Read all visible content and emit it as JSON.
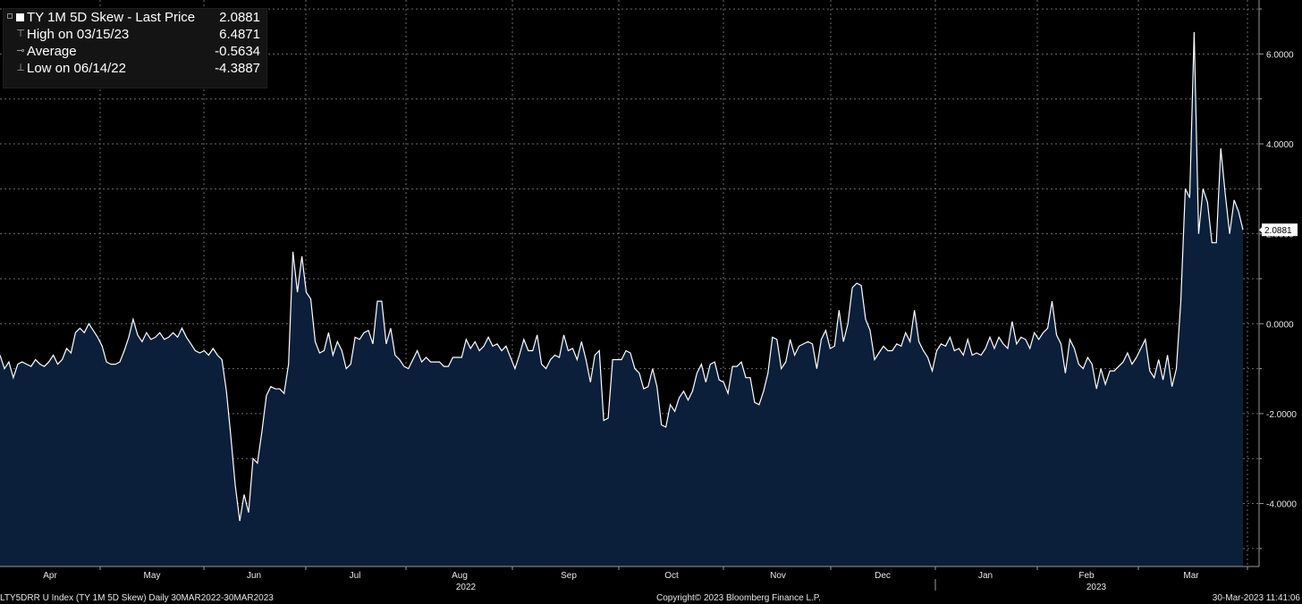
{
  "legend": {
    "series_label": "TY 1M 5D Skew - Last Price",
    "series_value": "2.0881",
    "high_label": "High on 03/15/23",
    "high_value": "6.4871",
    "avg_label": "Average",
    "avg_value": "-0.5634",
    "low_label": "Low on 06/14/22",
    "low_value": "-4.3887"
  },
  "footer": {
    "left": "LTY5DRR U Index (TY 1M 5D Skew)  Daily 30MAR2022-30MAR2023",
    "center": "Copyright© 2023 Bloomberg Finance L.P.",
    "right": "30-Mar-2023 11:41:06"
  },
  "colors": {
    "background": "#000000",
    "area_fill": "#0b1f3a",
    "line": "#ffffff",
    "grid": "#6a6a6a"
  },
  "chart_data": {
    "type": "area",
    "series": [
      {
        "values": [
          -0.7,
          -1.0,
          -0.85,
          -1.2,
          -0.9,
          -0.85,
          -0.9,
          -0.95,
          -0.8,
          -0.9,
          -0.95,
          -0.85,
          -0.7,
          -0.9,
          -0.8,
          -0.55,
          -0.65,
          -0.2,
          -0.1,
          -0.2,
          0.0,
          -0.15,
          -0.3,
          -0.5,
          -0.85,
          -0.9,
          -0.9,
          -0.85,
          -0.6,
          -0.3,
          0.1,
          -0.25,
          -0.4,
          -0.2,
          -0.35,
          -0.3,
          -0.2,
          -0.35,
          -0.3,
          -0.2,
          -0.3,
          -0.1,
          -0.3,
          -0.45,
          -0.6,
          -0.65,
          -0.6,
          -0.7,
          -0.55,
          -0.7,
          -0.8,
          -1.5,
          -2.5,
          -3.6,
          -4.3887,
          -3.8,
          -4.2,
          -3.0,
          -3.1,
          -2.4,
          -1.6,
          -1.4,
          -1.45,
          -1.45,
          -1.55,
          -0.9,
          1.6,
          0.7,
          1.5,
          0.7,
          0.55,
          -0.4,
          -0.65,
          -0.6,
          -0.2,
          -0.7,
          -0.4,
          -0.6,
          -1.0,
          -0.9,
          -0.3,
          -0.35,
          -0.2,
          -0.15,
          -0.45,
          0.5,
          0.5,
          -0.45,
          -0.1,
          -0.7,
          -0.8,
          -0.95,
          -1.0,
          -0.8,
          -0.6,
          -0.85,
          -0.75,
          -0.85,
          -0.85,
          -0.85,
          -0.95,
          -0.95,
          -0.75,
          -0.75,
          -0.75,
          -0.35,
          -0.55,
          -0.4,
          -0.6,
          -0.5,
          -0.3,
          -0.5,
          -0.45,
          -0.6,
          -0.5,
          -0.75,
          -1.0,
          -0.7,
          -0.35,
          -0.6,
          -0.6,
          -0.25,
          -0.9,
          -1.0,
          -0.8,
          -0.7,
          -0.75,
          -0.25,
          -0.6,
          -0.55,
          -0.8,
          -0.4,
          -0.8,
          -1.3,
          -0.7,
          -0.6,
          -2.15,
          -2.1,
          -0.8,
          -0.8,
          -0.8,
          -0.6,
          -0.65,
          -1.0,
          -1.1,
          -1.45,
          -1.4,
          -1.0,
          -1.4,
          -2.25,
          -2.3,
          -1.8,
          -1.95,
          -1.65,
          -1.5,
          -1.7,
          -1.5,
          -1.1,
          -0.9,
          -1.3,
          -0.9,
          -0.85,
          -1.25,
          -1.3,
          -1.55,
          -0.95,
          -0.95,
          -0.85,
          -1.2,
          -1.2,
          -1.75,
          -1.8,
          -1.5,
          -1.1,
          -0.3,
          -0.35,
          -1.0,
          -0.85,
          -0.35,
          -0.7,
          -0.5,
          -0.45,
          -0.4,
          -0.45,
          -1.0,
          -0.35,
          -0.15,
          -0.55,
          -0.5,
          0.3,
          -0.4,
          0.0,
          0.8,
          0.9,
          0.85,
          0.1,
          -0.15,
          -0.8,
          -0.65,
          -0.5,
          -0.6,
          -0.6,
          -0.45,
          -0.5,
          -0.2,
          -0.4,
          0.3,
          -0.4,
          -0.6,
          -0.75,
          -1.05,
          -0.6,
          -0.45,
          -0.5,
          -0.3,
          -0.6,
          -0.55,
          -0.7,
          -0.35,
          -0.7,
          -0.65,
          -0.7,
          -0.55,
          -0.3,
          -0.55,
          -0.3,
          -0.45,
          -0.55,
          0.05,
          -0.45,
          -0.3,
          -0.35,
          -0.55,
          -0.2,
          -0.35,
          -0.2,
          -0.1,
          0.5,
          -0.25,
          -0.45,
          -1.1,
          -0.35,
          -0.55,
          -0.9,
          -1.0,
          -0.75,
          -0.9,
          -1.45,
          -1.0,
          -1.35,
          -1.05,
          -1.05,
          -0.95,
          -0.85,
          -0.65,
          -0.9,
          -0.75,
          -0.55,
          -0.35,
          -1.05,
          -1.2,
          -0.8,
          -1.25,
          -0.7,
          -1.4,
          -1.0,
          0.5,
          3.0,
          2.8,
          6.4871,
          2.0,
          3.0,
          2.7,
          1.8,
          1.8,
          3.9,
          2.9,
          2.0,
          2.75,
          2.5,
          2.0881
        ]
      }
    ],
    "x_month_labels": [
      "Apr",
      "May",
      "Jun",
      "Jul",
      "Aug",
      "Sep",
      "Oct",
      "Nov",
      "Dec",
      "Jan",
      "Feb",
      "Mar"
    ],
    "x_year_labels": [
      "2022",
      "2023"
    ],
    "y_ticks": [
      "6.0000",
      "4.0000",
      "2.0000",
      "0.0000",
      "-2.0000",
      "-4.0000"
    ],
    "y_tick_values": [
      6,
      4,
      2,
      0,
      -2,
      -4
    ],
    "ylim": [
      -5.4,
      7.2
    ],
    "last_value_label": "2.0881",
    "grid": true
  }
}
